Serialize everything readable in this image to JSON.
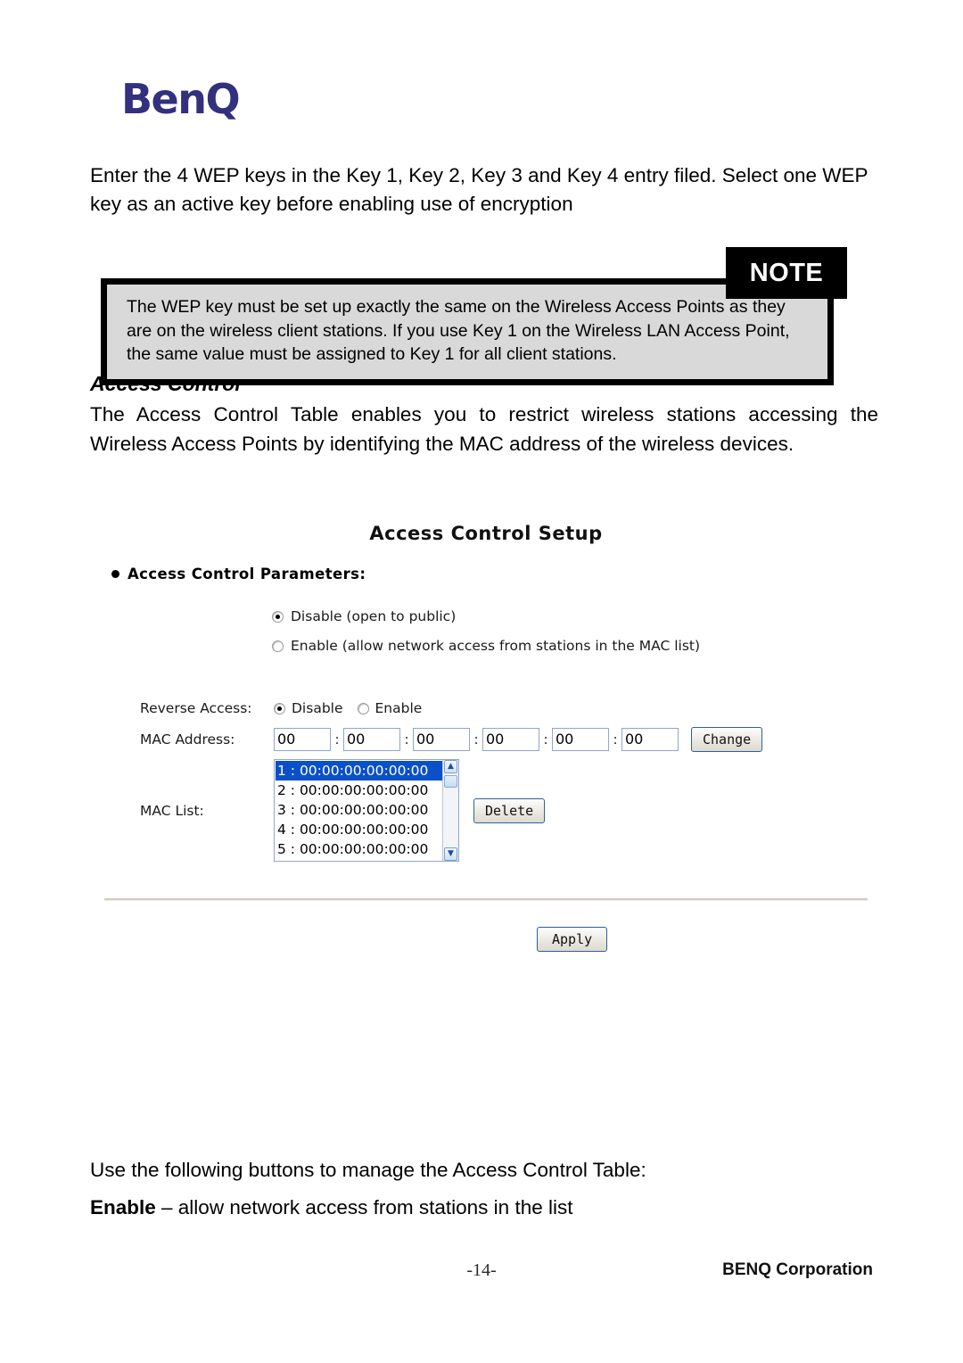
{
  "brand": {
    "logo_text": "BenQ",
    "logo_color": "#33307d"
  },
  "intro_paragraph": "Enter the 4 WEP keys in the Key 1, Key 2, Key 3 and Key 4 entry filed.   Select one WEP key as an active key before enabling use of encryption",
  "note": {
    "tab_label": "NOTE",
    "text": "The WEP key must be set up exactly the same on the Wireless Access Points as they are on the wireless client stations. If you use Key 1 on the Wireless LAN Access Point, the same value must be assigned to Key 1 for all client stations.",
    "background": "#d9d9d9",
    "border_color": "#000000"
  },
  "section": {
    "heading": "Access Control",
    "paragraph": "The Access Control Table enables you to restrict wireless stations accessing the Wireless Access Points by identifying the MAC address of the wireless devices."
  },
  "ui": {
    "title": "Access Control Setup",
    "params_label": "Access Control Parameters:",
    "access_options": [
      {
        "label": "Disable (open to public)",
        "selected": true
      },
      {
        "label": "Enable (allow network access from stations in the MAC list)",
        "selected": false
      }
    ],
    "reverse_access": {
      "label": "Reverse Access:",
      "options": [
        {
          "label": "Disable",
          "selected": true
        },
        {
          "label": "Enable",
          "selected": false
        }
      ]
    },
    "mac_address": {
      "label": "MAC Address:",
      "separator": ":",
      "octets": [
        "00",
        "00",
        "00",
        "00",
        "00",
        "00"
      ],
      "change_button": "Change"
    },
    "mac_list": {
      "label": "MAC List:",
      "items": [
        {
          "text": "1 : 00:00:00:00:00:00",
          "selected": true
        },
        {
          "text": "2 : 00:00:00:00:00:00",
          "selected": false
        },
        {
          "text": "3 : 00:00:00:00:00:00",
          "selected": false
        },
        {
          "text": "4 : 00:00:00:00:00:00",
          "selected": false
        },
        {
          "text": "5 : 00:00:00:00:00:00",
          "selected": false
        }
      ],
      "delete_button": "Delete",
      "scroll_up_icon": "chevron-up-icon",
      "scroll_down_icon": "chevron-down-icon",
      "selection_color": "#0a50c8"
    },
    "apply_button": "Apply"
  },
  "manage_paragraph": "Use the following buttons to manage the Access Control Table:",
  "enable_entry": {
    "term": "Enable",
    "description": " – allow network access from stations in the list"
  },
  "footer": {
    "page_number": "-14-",
    "corporation": "BENQ Corporation"
  }
}
